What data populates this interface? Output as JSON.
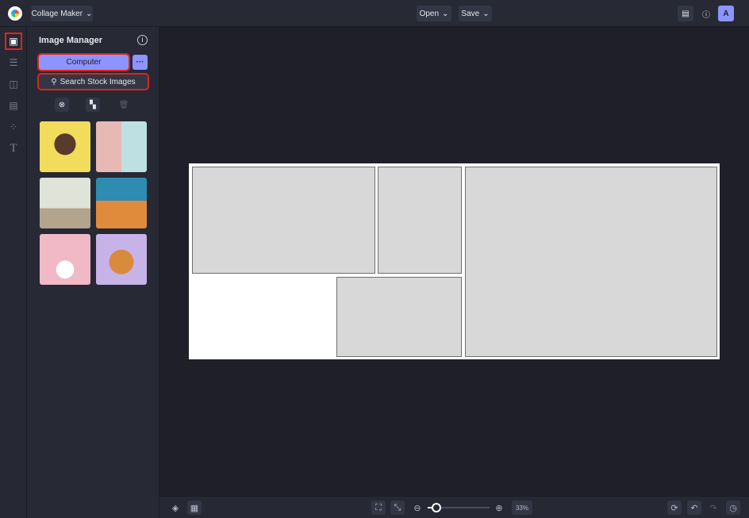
{
  "header": {
    "app_menu": "Collage Maker",
    "open": "Open",
    "save": "Save",
    "avatar": "A"
  },
  "panel": {
    "title": "Image Manager",
    "computer": "Computer",
    "more": "···",
    "search": "Search Stock Images"
  },
  "thumbnails": [
    {
      "name": "woman-portrait",
      "color": "#f2dc5c"
    },
    {
      "name": "doors",
      "color": "#e7b9b4"
    },
    {
      "name": "bicycle-wall",
      "color": "#c9d2c0"
    },
    {
      "name": "man-beach",
      "color": "#2e8cb0"
    },
    {
      "name": "wedding-blossoms",
      "color": "#f1b8c6"
    },
    {
      "name": "shiba-dog",
      "color": "#c7b3e8"
    }
  ],
  "bottom": {
    "zoom": "33%",
    "zoom_fraction": 0.1
  },
  "colors": {
    "accent": "#8c94ff",
    "highlight": "#e0241b"
  }
}
